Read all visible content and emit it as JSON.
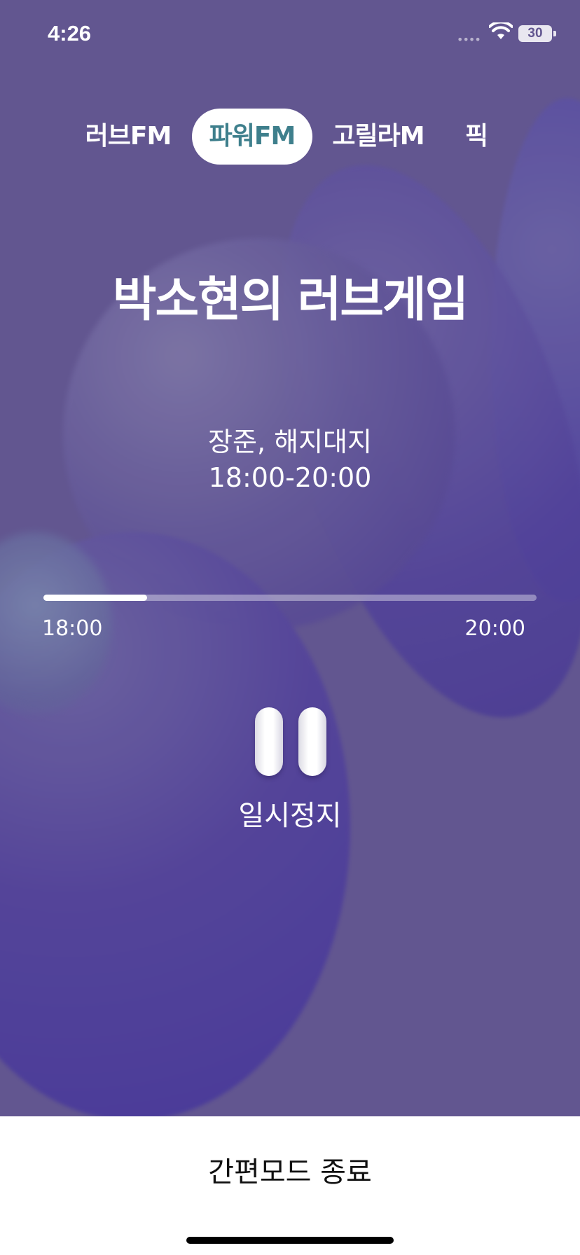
{
  "status_bar": {
    "time": "4:26",
    "signal": "••••",
    "battery": "30"
  },
  "channels": [
    {
      "label": "러브FM",
      "active": false
    },
    {
      "label": "파워FM",
      "active": true
    },
    {
      "label": "고릴라M",
      "active": false
    },
    {
      "label": "픽",
      "active": false
    }
  ],
  "program": {
    "title": "박소현의 러브게임",
    "hosts": "장준, 해지대지",
    "time_range": "18:00-20:00"
  },
  "progress": {
    "start_label": "18:00",
    "end_label": "20:00",
    "fraction": 0.21
  },
  "player": {
    "pause_label": "일시정지",
    "icon": "pause-icon"
  },
  "footer": {
    "exit_label": "간편모드 종료"
  },
  "colors": {
    "background": "#625690",
    "active_tab_text": "#3e7f8c",
    "sheet": "#ffffff"
  }
}
